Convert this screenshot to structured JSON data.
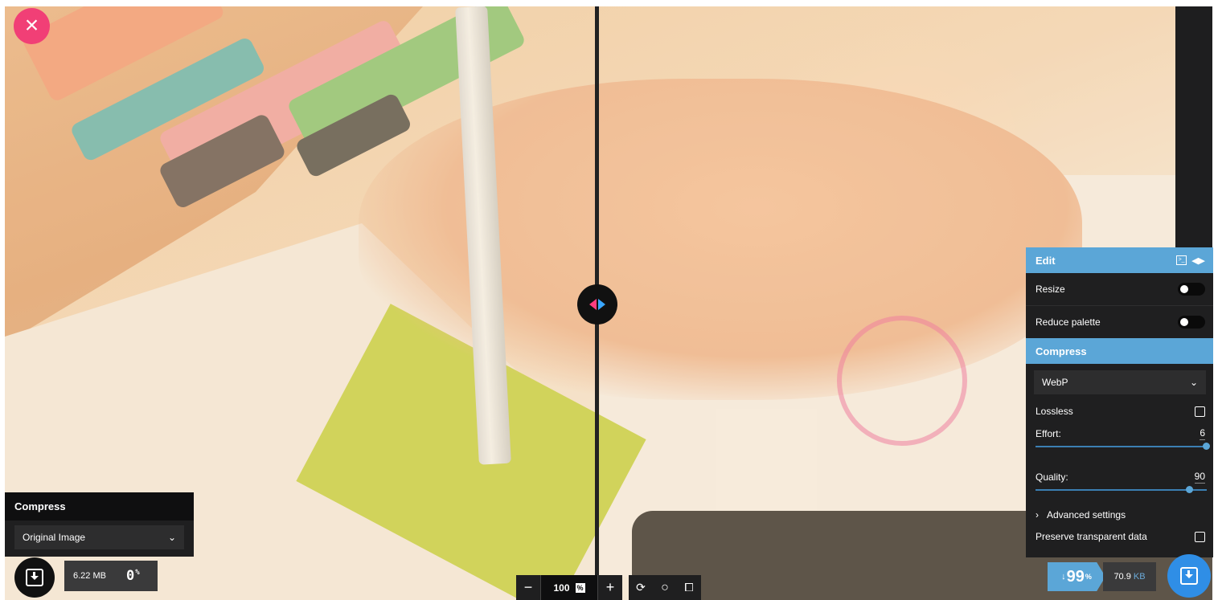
{
  "close_button": {
    "icon": "close-icon",
    "glyph": "×"
  },
  "edit_panel": {
    "title": "Edit",
    "resize_label": "Resize",
    "reduce_palette_label": "Reduce palette"
  },
  "compress_panel": {
    "title": "Compress",
    "format_value": "WebP",
    "lossless_label": "Lossless",
    "effort_label": "Effort:",
    "effort_value": "6",
    "effort_fraction": 1.0,
    "quality_label": "Quality:",
    "quality_value": "90",
    "quality_fraction": 0.9,
    "advanced_label": "Advanced settings",
    "preserve_label": "Preserve transparent data"
  },
  "left_panel": {
    "title": "Compress",
    "select_value": "Original Image"
  },
  "left_stats": {
    "size": "6.22 MB",
    "percent": "0",
    "percent_sign": "%"
  },
  "right_stats": {
    "arrow": "↓",
    "percent": "99",
    "percent_sign": "%",
    "size": "70.9",
    "unit": "KB"
  },
  "zoom": {
    "minus": "−",
    "value": "100",
    "unit_glyph": "%",
    "plus": "+",
    "rotate": "⟳",
    "background": "○",
    "fit": "⧠"
  }
}
